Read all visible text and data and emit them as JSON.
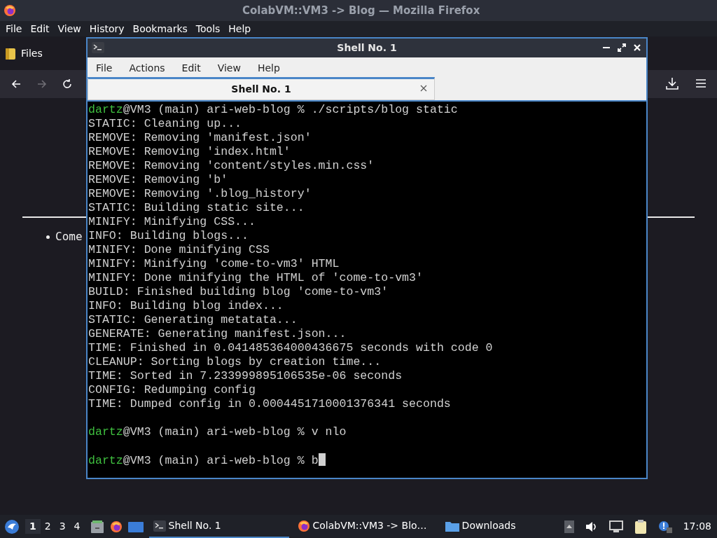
{
  "browser": {
    "title": "ColabVM::VM3 -> Blog — Mozilla Firefox",
    "menu": [
      "File",
      "Edit",
      "View",
      "History",
      "Bookmarks",
      "Tools",
      "Help"
    ],
    "tab": {
      "label": "Files"
    },
    "content": {
      "bullet": "Come"
    }
  },
  "terminal": {
    "title": "Shell No. 1",
    "menu": [
      "File",
      "Actions",
      "Edit",
      "View",
      "Help"
    ],
    "tabs": [
      {
        "label": "Shell No. 1",
        "selected": true
      }
    ],
    "lines": [
      {
        "kind": "prompt",
        "user": "dartz",
        "rest": "@VM3 (main) ari-web-blog % ./scripts/blog static"
      },
      {
        "kind": "output",
        "text": "STATIC: Cleaning up..."
      },
      {
        "kind": "output",
        "text": "REMOVE: Removing 'manifest.json'"
      },
      {
        "kind": "output",
        "text": "REMOVE: Removing 'index.html'"
      },
      {
        "kind": "output",
        "text": "REMOVE: Removing 'content/styles.min.css'"
      },
      {
        "kind": "output",
        "text": "REMOVE: Removing 'b'"
      },
      {
        "kind": "output",
        "text": "REMOVE: Removing '.blog_history'"
      },
      {
        "kind": "output",
        "text": "STATIC: Building static site..."
      },
      {
        "kind": "output",
        "text": "MINIFY: Minifying CSS..."
      },
      {
        "kind": "output",
        "text": "INFO: Building blogs..."
      },
      {
        "kind": "output",
        "text": "MINIFY: Done minifying CSS"
      },
      {
        "kind": "output",
        "text": "MINIFY: Minifying 'come-to-vm3' HTML"
      },
      {
        "kind": "output",
        "text": "MINIFY: Done minifying the HTML of 'come-to-vm3'"
      },
      {
        "kind": "output",
        "text": "BUILD: Finished building blog 'come-to-vm3'"
      },
      {
        "kind": "output",
        "text": "INFO: Building blog index..."
      },
      {
        "kind": "output",
        "text": "STATIC: Generating metatata..."
      },
      {
        "kind": "output",
        "text": "GENERATE: Generating manifest.json..."
      },
      {
        "kind": "output",
        "text": "TIME: Finished in 0.041485364000436675 seconds with code 0"
      },
      {
        "kind": "output",
        "text": "CLEANUP: Sorting blogs by creation time..."
      },
      {
        "kind": "output",
        "text": "TIME: Sorted in 7.233999895106535e-06 seconds"
      },
      {
        "kind": "output",
        "text": "CONFIG: Redumping config"
      },
      {
        "kind": "output",
        "text": "TIME: Dumped config in 0.0004451710001376341 seconds"
      },
      {
        "kind": "blank"
      },
      {
        "kind": "prompt",
        "user": "dartz",
        "rest": "@VM3 (main) ari-web-blog % v nlo"
      },
      {
        "kind": "blank"
      },
      {
        "kind": "prompt",
        "user": "dartz",
        "rest": "@VM3 (main) ari-web-blog % b",
        "cursor": true
      }
    ]
  },
  "taskbar": {
    "workspaces": [
      {
        "label": "1",
        "selected": true
      },
      {
        "label": "2",
        "selected": false
      },
      {
        "label": "3",
        "selected": false
      },
      {
        "label": "4",
        "selected": false
      }
    ],
    "tasks": [
      {
        "label": "Shell No. 1",
        "kind": "terminal",
        "selected": true
      },
      {
        "label": "ColabVM::VM3 -> Blo…",
        "kind": "firefox",
        "selected": false
      },
      {
        "label": "Downloads",
        "kind": "folder",
        "selected": false
      }
    ],
    "clock": "17:08"
  }
}
